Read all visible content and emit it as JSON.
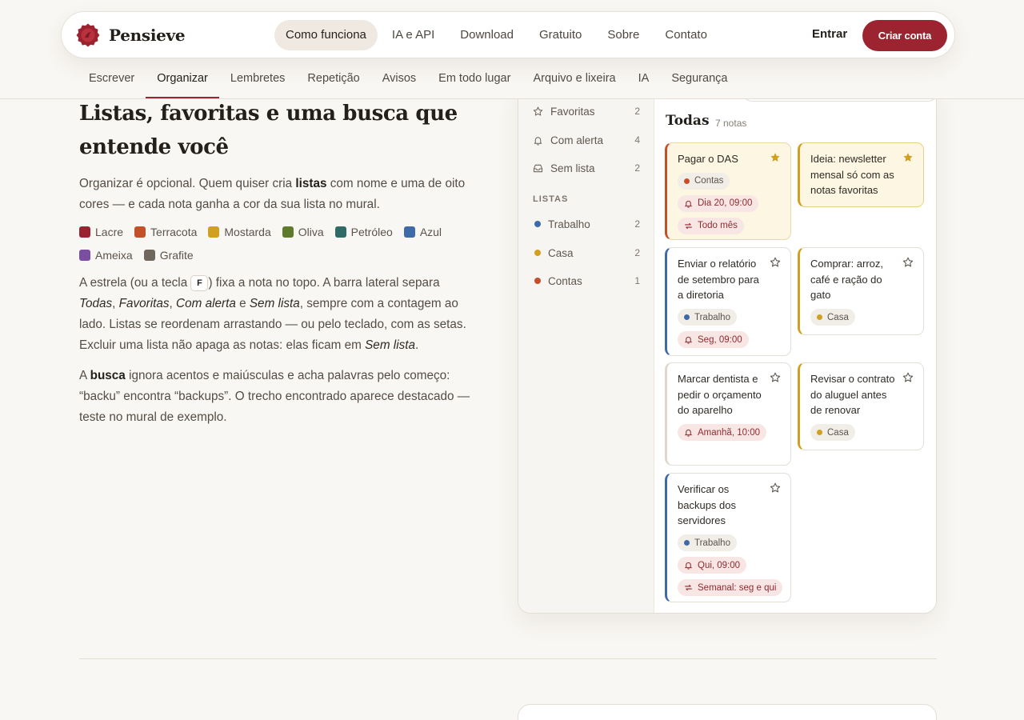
{
  "brand": {
    "name": "Pensieve"
  },
  "nav": {
    "links": [
      "Como funciona",
      "IA e API",
      "Download",
      "Gratuito",
      "Sobre",
      "Contato"
    ],
    "active": "Como funciona",
    "login": "Entrar",
    "signup": "Criar conta"
  },
  "subnav": {
    "tabs": [
      "Escrever",
      "Organizar",
      "Lembretes",
      "Repetição",
      "Avisos",
      "Em todo lugar",
      "Arquivo e lixeira",
      "IA",
      "Segurança"
    ],
    "active": "Organizar"
  },
  "article": {
    "title": "Listas, favoritas e uma busca que entende você",
    "p1": {
      "a": "Organizar é opcional. Quem quiser cria ",
      "b": "listas",
      "c": " com nome e uma de oito cores — e cada nota ganha a cor da sua lista no mural."
    },
    "colors": [
      {
        "name": "Lacre",
        "hex": "#9b2330"
      },
      {
        "name": "Terracota",
        "hex": "#c4502a"
      },
      {
        "name": "Mostarda",
        "hex": "#d1a020"
      },
      {
        "name": "Oliva",
        "hex": "#5e7a2c"
      },
      {
        "name": "Petróleo",
        "hex": "#2e6b66"
      },
      {
        "name": "Azul",
        "hex": "#3f6aa8"
      },
      {
        "name": "Ameixa",
        "hex": "#7a4ea0"
      },
      {
        "name": "Grafite",
        "hex": "#6f665c"
      }
    ],
    "p2": {
      "a": "A estrela (ou a tecla ",
      "key": "F",
      "b": ") fixa a nota no topo. A barra lateral separa ",
      "i1": "Todas",
      "s1": ", ",
      "i2": "Favoritas",
      "s2": ", ",
      "i3": "Com alerta",
      "s3": " e ",
      "i4": "Sem lista",
      "c": ", sempre com a contagem ao lado. Listas se reordenam arrastando — ou pelo teclado, com as setas. Excluir uma lista não apaga as notas: elas ficam em ",
      "i5": "Sem lista",
      "d": "."
    },
    "p3": {
      "a": "A ",
      "b": "busca",
      "c": " ignora acentos e maiúsculas e acha palavras pelo começo: “backu” encontra “backups”. O trecho encontrado aparece destacado — teste no mural de exemplo."
    }
  },
  "mock": {
    "sidebar": {
      "filters": [
        {
          "label": "Favoritas",
          "count": "2",
          "icon": "star-icon"
        },
        {
          "label": "Com alerta",
          "count": "4",
          "icon": "bell-icon"
        },
        {
          "label": "Sem lista",
          "count": "2",
          "icon": "inbox-icon"
        }
      ],
      "lists_heading": "LISTAS",
      "lists": [
        {
          "label": "Trabalho",
          "count": "2",
          "color": "#3f6aa8"
        },
        {
          "label": "Casa",
          "count": "2",
          "color": "#d1a020"
        },
        {
          "label": "Contas",
          "count": "1",
          "color": "#c4502a"
        }
      ]
    },
    "main": {
      "title": "Todas",
      "count": "7 notas"
    },
    "notes": [
      {
        "text": "Pagar o DAS",
        "starred": true,
        "list": "Contas",
        "alert": "Dia 20, 09:00",
        "repeat": "Todo mês"
      },
      {
        "text": "Ideia: newsletter mensal só com as notas favoritas",
        "starred": true
      },
      {
        "text": "Enviar o relatório de setembro para a diretoria",
        "starred": false,
        "list": "Trabalho",
        "alert": "Seg, 09:00"
      },
      {
        "text": "Comprar: arroz, café e ração do gato",
        "starred": false,
        "list": "Casa"
      },
      {
        "text": "Marcar dentista e pedir o orçamento do aparelho",
        "starred": false,
        "alert": "Amanhã, 10:00"
      },
      {
        "text": "Revisar o contrato do aluguel antes de renovar",
        "starred": false,
        "list": "Casa"
      },
      {
        "text": "Verificar os backups dos servidores",
        "starred": false,
        "list": "Trabalho",
        "alert": "Qui, 09:00",
        "repeat": "Semanal: seg e qui"
      }
    ]
  }
}
